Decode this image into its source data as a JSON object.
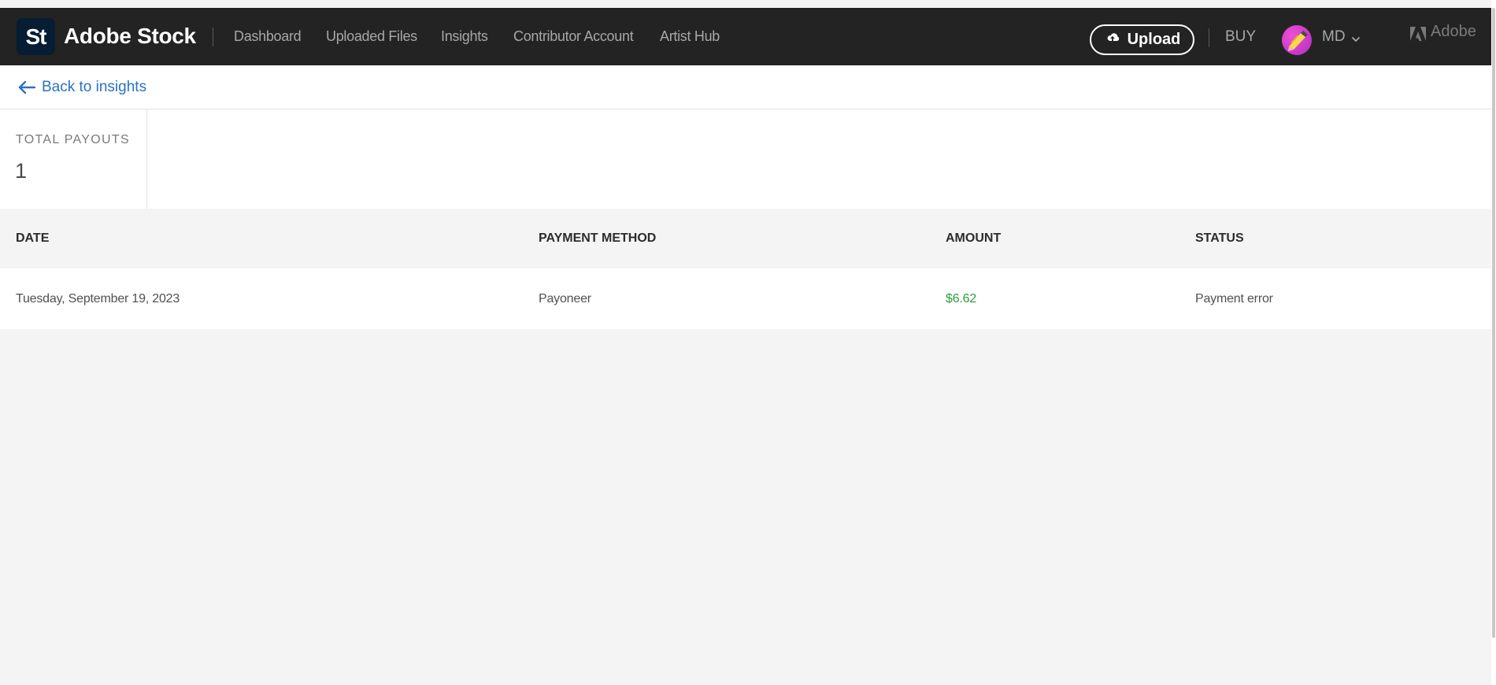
{
  "header": {
    "logo_text": "St",
    "brand": "Adobe Stock",
    "nav": [
      "Dashboard",
      "Uploaded Files",
      "Insights",
      "Contributor Account",
      "Artist Hub"
    ],
    "upload_label": "Upload",
    "buy_label": "BUY",
    "user_initials": "MD",
    "adobe_label": "Adobe"
  },
  "back": {
    "label": "Back to insights"
  },
  "stats": {
    "label": "TOTAL PAYOUTS",
    "value": "1"
  },
  "table": {
    "columns": [
      "DATE",
      "PAYMENT METHOD",
      "AMOUNT",
      "STATUS"
    ],
    "rows": [
      {
        "date": "Tuesday, September 19, 2023",
        "method": "Payoneer",
        "amount": "$6.62",
        "status": "Payment error"
      }
    ]
  },
  "colors": {
    "header_bg": "#232323",
    "link": "#2a72c4",
    "amount": "#2d9d3c",
    "page_bg": "#f4f4f4"
  },
  "icons": [
    "upload-cloud-icon",
    "arrow-left-icon",
    "chevron-down-icon",
    "adobe-logo-icon",
    "avatar"
  ]
}
